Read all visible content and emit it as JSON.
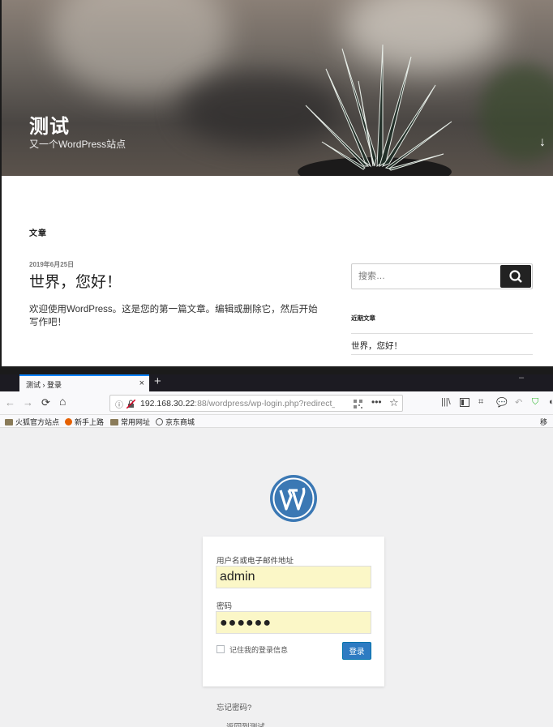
{
  "site": {
    "title": "测试",
    "description": "又一个WordPress站点",
    "scroll_icon": "↓",
    "section_title": "文章",
    "post": {
      "date": "2019年6月25日",
      "title": "世界，您好！",
      "excerpt": "欢迎使用WordPress。这是您的第一篇文章。编辑或删除它，然后开始写作吧！"
    },
    "search": {
      "placeholder": "搜索…",
      "icon": "search-icon"
    },
    "widget": {
      "title": "近期文章",
      "items": [
        "世界，您好！"
      ]
    }
  },
  "browser": {
    "tab": {
      "title": "测试 › 登录",
      "close": "×"
    },
    "new_tab": "+",
    "url": {
      "host": "192.168.30.22",
      "path": ":88/wordpress/wp-login.php?redirect_"
    },
    "nav_icons": {
      "back": "←",
      "forward": "→",
      "reload": "⟳",
      "home": "⌂"
    },
    "bookmarks": [
      "火狐官方站点",
      "新手上路",
      "常用网址",
      "京东商城"
    ],
    "bookmarks_overflow": "移"
  },
  "login": {
    "username_label": "用户名或电子邮件地址",
    "username_value": "admin",
    "password_label": "密码",
    "password_value": "●●●●●●",
    "remember_label": "记住我的登录信息",
    "submit_label": "登录",
    "lost_password": "忘记密码?",
    "back_link": "← 返回到测试"
  },
  "colors": {
    "accent": "#2e7bc2",
    "autofill": "#fbf7c7",
    "tab_accent": "#0a84ff"
  }
}
